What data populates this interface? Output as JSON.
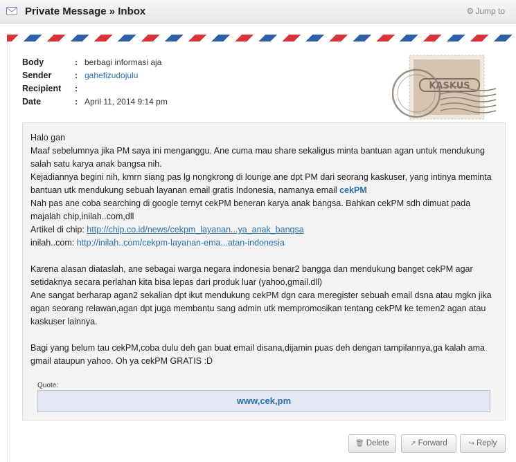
{
  "header": {
    "title": "Private Message » Inbox",
    "jump_label": "Jump to"
  },
  "meta": {
    "body_label": "Body",
    "body_value": "berbagi informasi aja",
    "sender_label": "Sender",
    "sender_value": "gahefizudojulu",
    "recipient_label": "Recipient",
    "recipient_value": "",
    "date_label": "Date",
    "date_value": "April 11, 2014 9:14 pm",
    "colon": ":"
  },
  "stamp": {
    "brand": "KASKUS"
  },
  "message": {
    "l1": "Halo gan",
    "l2": "Maaf sebelumnya jika PM saya ini menganggu. Ane cuma mau share sekaligus minta bantuan agan untuk mendukung salah satu karya anak bangsa nih.",
    "l3": "Kejadiannya begini nih, kmrn siang pas lg nongkrong di lounge ane dpt PM dari seorang kaskuser, yang intinya meminta bantuan utk mendukung sebuah layanan email gratis Indonesia, namanya email",
    "l3_brand": "cekPM",
    "l4": "Nah pas ane coba searching di google ternyt cekPM beneran karya anak bangsa. Bahkan cekPM sdh dimuat pada majalah chip,inilah..com,dll",
    "l5_prefix": "Artikel di chip:",
    "l5_link": "http://chip.co.id/news/cekpm_layanan...ya_anak_bangsa",
    "l6_prefix": "inilah..com:",
    "l6_link": "http://inilah..com/cekpm-layanan-ema...atan-indonesia",
    "l7": "Karena alasan diataslah, ane sebagai warga negara indonesia benar2 bangga dan mendukung banget cekPM agar setidaknya secara perlahan kita bisa lepas dari produk luar (yahoo,gmail.dll)",
    "l8": "Ane sangat berharap agan2 sekalian dpt ikut mendukung cekPM dgn cara meregister sebuah email dsna atau mgkn jika agan seorang relawan,agan dpt juga membantu sang admin utk mempromosikan tentang cekPM ke temen2 agan atau kaskuser lainnya.",
    "l9": "Bagi yang belum tau cekPM,coba dulu deh gan buat email disana,dijamin puas deh dengan tampilannya,ga kalah ama gmail ataupun yahoo. Oh ya cekPM GRATIS :D"
  },
  "quote": {
    "label": "Quote:",
    "text": "www,cek,pm"
  },
  "actions": {
    "delete_label": "Delete",
    "forward_label": "Forward",
    "reply_label": "Reply"
  },
  "colors": {
    "link": "#2a6fa8",
    "airmail_red": "#d9343a",
    "airmail_blue": "#2f5fa9",
    "quote_bg": "#e3e7f1"
  }
}
